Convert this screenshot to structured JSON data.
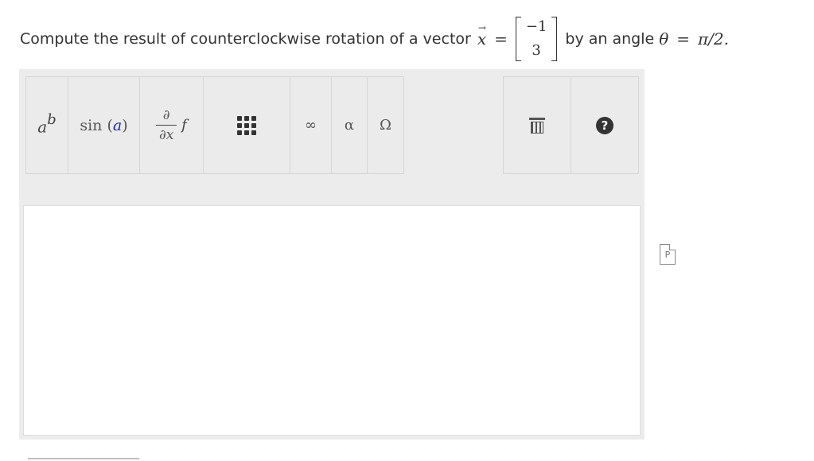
{
  "question": {
    "prefix": "Compute the result of counterclockwise rotation of a vector",
    "vector_symbol": "x",
    "vector_arrow": "→",
    "equals": "=",
    "matrix": [
      "−1",
      "3"
    ],
    "suffix": "by an angle",
    "angle_symbol": "θ",
    "angle_value": "π/2."
  },
  "toolbar": {
    "power_base": "a",
    "power_exp": "b",
    "sin_func": "sin",
    "sin_arg": "a",
    "deriv_num": "∂",
    "deriv_den": "∂x",
    "deriv_func": "f",
    "infinity": "∞",
    "alpha": "α",
    "omega": "Ω",
    "help": "?"
  },
  "preview": {
    "label": "P"
  },
  "icons": {
    "trash": "trash-icon",
    "help": "help-icon",
    "matrix": "matrix-grid-icon",
    "preview": "preview-icon"
  }
}
